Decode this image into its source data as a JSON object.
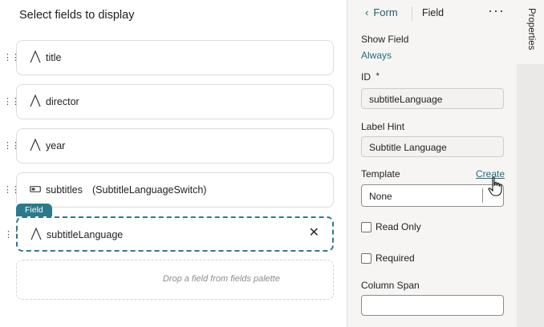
{
  "canvas": {
    "title": "Select fields to display",
    "fields": [
      {
        "label": "title",
        "icon": "text-field-icon",
        "extra": ""
      },
      {
        "label": "director",
        "icon": "text-field-icon",
        "extra": ""
      },
      {
        "label": "year",
        "icon": "text-field-icon",
        "extra": ""
      },
      {
        "label": "subtitles",
        "icon": "switch-field-icon",
        "extra": "(SubtitleLanguageSwitch)"
      },
      {
        "label": "subtitleLanguage",
        "icon": "text-field-icon",
        "extra": ""
      }
    ],
    "selected_tag": "Field",
    "drop_hint": "Drop a field from fields palette"
  },
  "panel": {
    "back_label": "Form",
    "current": "Field",
    "more_icon": "more-icon",
    "show_field_label": "Show Field",
    "show_field_value": "Always",
    "id_label": "ID",
    "id_required": "*",
    "id_value": "subtitleLanguage",
    "label_hint_label": "Label Hint",
    "label_hint_value": "Subtitle Language",
    "template_label": "Template",
    "template_create": "Create",
    "template_value": "None",
    "read_only_label": "Read Only",
    "required_label": "Required",
    "column_span_label": "Column Span",
    "column_span_value": ""
  },
  "side_tab": {
    "label": "Properties"
  },
  "colors": {
    "accent": "#2b7a8c",
    "link": "#1f6e80",
    "panel_bg": "#f6f5f4"
  }
}
